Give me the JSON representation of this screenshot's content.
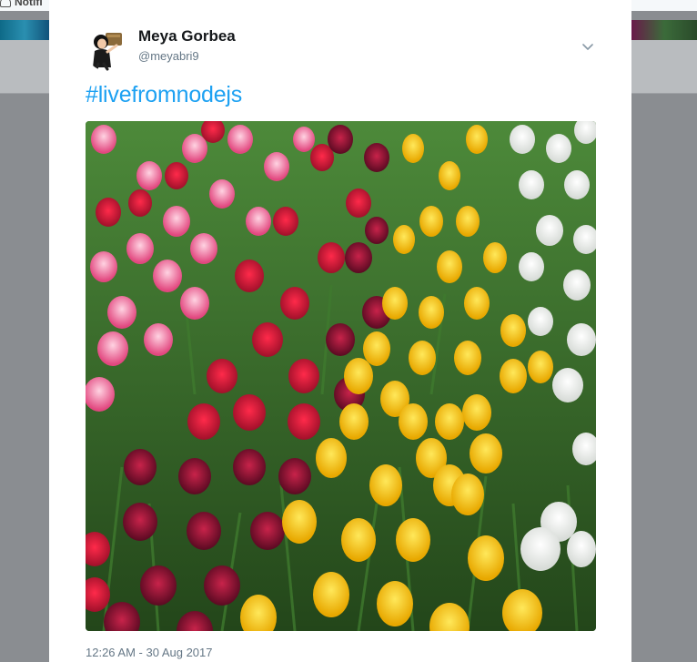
{
  "background": {
    "notifications_label": "Notifi",
    "notifications_icon": "bell-icon"
  },
  "tweet": {
    "display_name": "Meya Gorbea",
    "handle": "@meyabri9",
    "hashtag": "#livefromnodejs",
    "timestamp": "12:26 AM - 30 Aug 2017",
    "caret_icon": "chevron-down-icon",
    "photo_description_icon": "tulip-field-photo"
  },
  "colors": {
    "hashtag": "#1da1f2",
    "name": "#14171a",
    "secondary": "#657786",
    "overlay": "#8a8d91"
  }
}
